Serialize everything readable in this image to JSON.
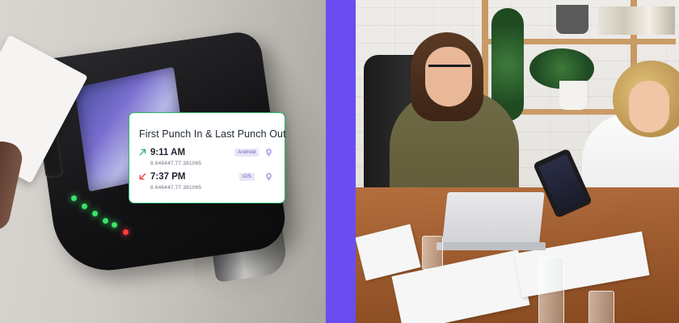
{
  "punch_card": {
    "title": "First Punch In & Last Punch Out",
    "entries": [
      {
        "direction": "in",
        "arrow_icon": "arrow-up-right-icon",
        "arrow_color": "#2db56e",
        "time": "9:11 AM",
        "coordinates": "8.646447,77.381065",
        "platform": "Android",
        "pin_icon": "location-pin-icon"
      },
      {
        "direction": "out",
        "arrow_icon": "arrow-down-left-icon",
        "arrow_color": "#e0463a",
        "time": "7:37 PM",
        "coordinates": "8.646447,77.381065",
        "platform": "iOS",
        "pin_icon": "location-pin-icon"
      }
    ]
  },
  "colors": {
    "accent_divider": "#6a4df0",
    "card_border": "#2db56e",
    "badge_bg": "#e8e7f7",
    "badge_text": "#6a63c4",
    "pin": "#b8b6ea"
  }
}
